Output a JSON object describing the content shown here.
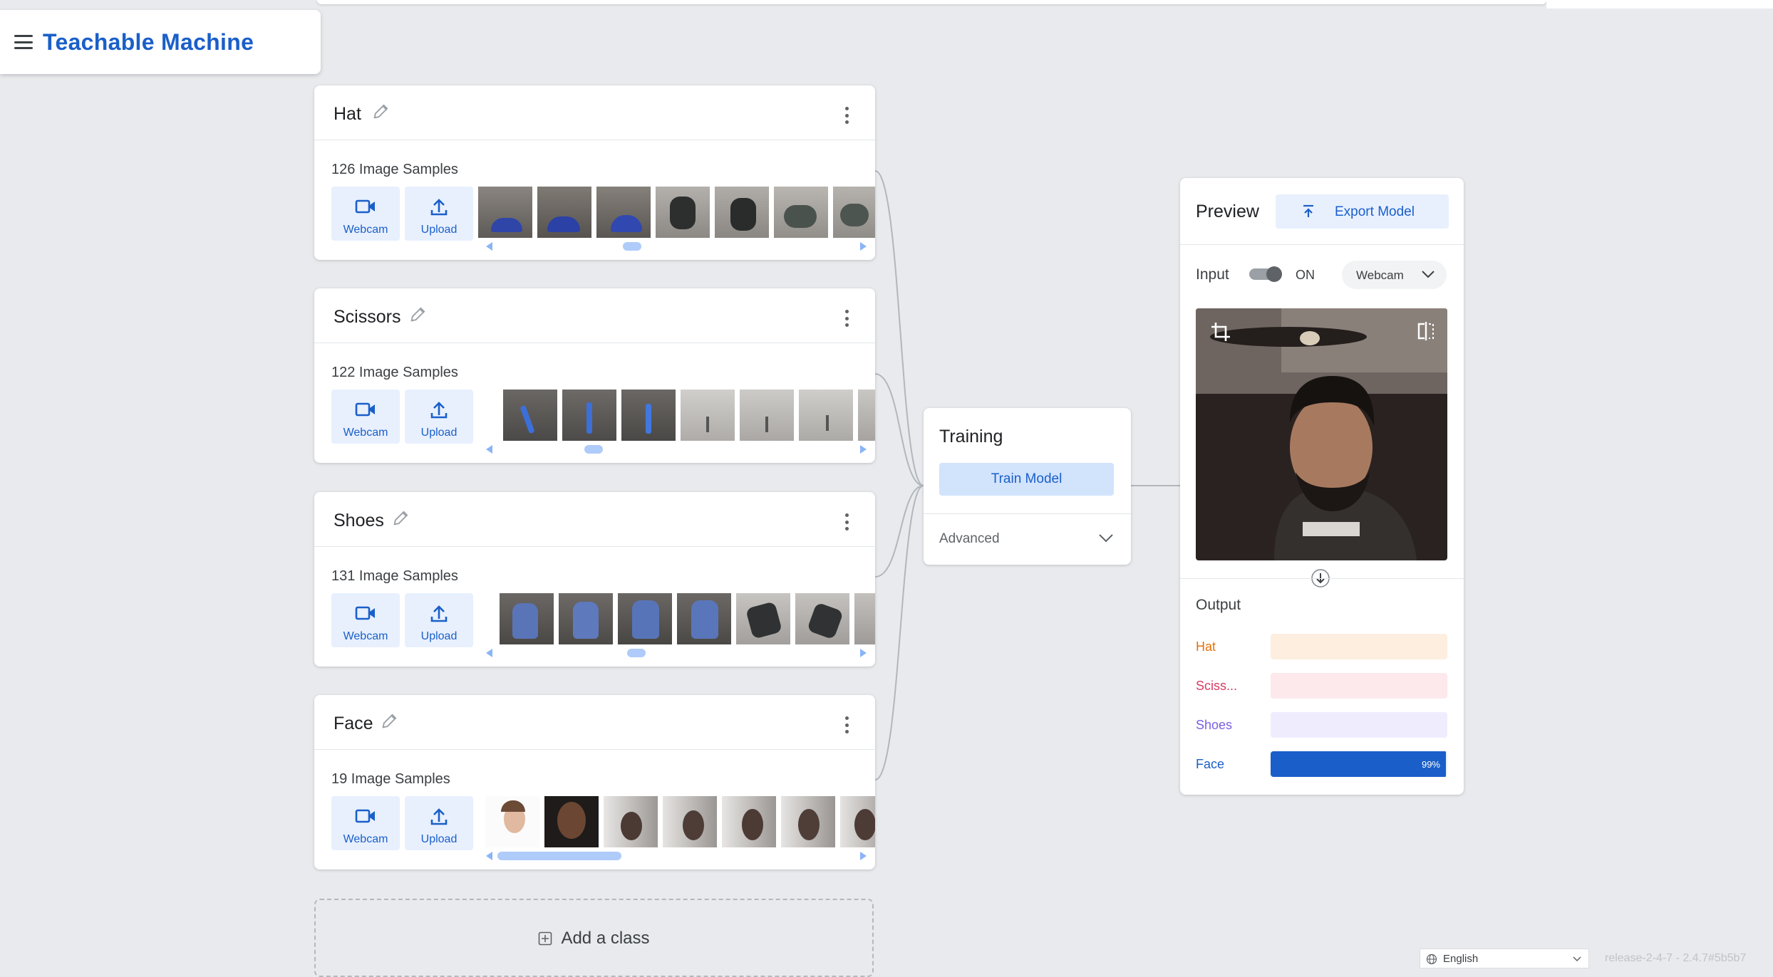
{
  "app": {
    "title": "Teachable Machine"
  },
  "classes": [
    {
      "name": "Hat",
      "samples_label": "126 Image Samples",
      "webcam_label": "Webcam",
      "upload_label": "Upload"
    },
    {
      "name": "Scissors",
      "samples_label": "122 Image Samples",
      "webcam_label": "Webcam",
      "upload_label": "Upload"
    },
    {
      "name": "Shoes",
      "samples_label": "131 Image Samples",
      "webcam_label": "Webcam",
      "upload_label": "Upload"
    },
    {
      "name": "Face",
      "samples_label": "19 Image Samples",
      "webcam_label": "Webcam",
      "upload_label": "Upload"
    }
  ],
  "add_class": {
    "label": "Add a class"
  },
  "training": {
    "title": "Training",
    "button_label": "Train Model",
    "advanced_label": "Advanced"
  },
  "preview": {
    "title": "Preview",
    "export_label": "Export Model",
    "input_label": "Input",
    "toggle_state": "ON",
    "source_label": "Webcam",
    "output_label": "Output",
    "outputs": [
      {
        "name": "Hat",
        "value": 0,
        "value_label": "",
        "color": "#e8710a",
        "bg": "#fdeee0"
      },
      {
        "name": "Sciss...",
        "value": 0,
        "value_label": "",
        "color": "#d93a63",
        "bg": "#fde8ec"
      },
      {
        "name": "Shoes",
        "value": 0,
        "value_label": "",
        "color": "#7b5ee0",
        "bg": "#efedfd"
      },
      {
        "name": "Face",
        "value": 0.99,
        "value_label": "99%",
        "color": "#1a5fc9",
        "bg": "#e8f0fe"
      }
    ]
  },
  "footer": {
    "language": "English",
    "version": "release-2-4-7 - 2.4.7#5b5b7"
  },
  "colors": {
    "accent": "#1a5fc9",
    "accent_light": "#e8f0fe",
    "background": "#e8eaed"
  }
}
